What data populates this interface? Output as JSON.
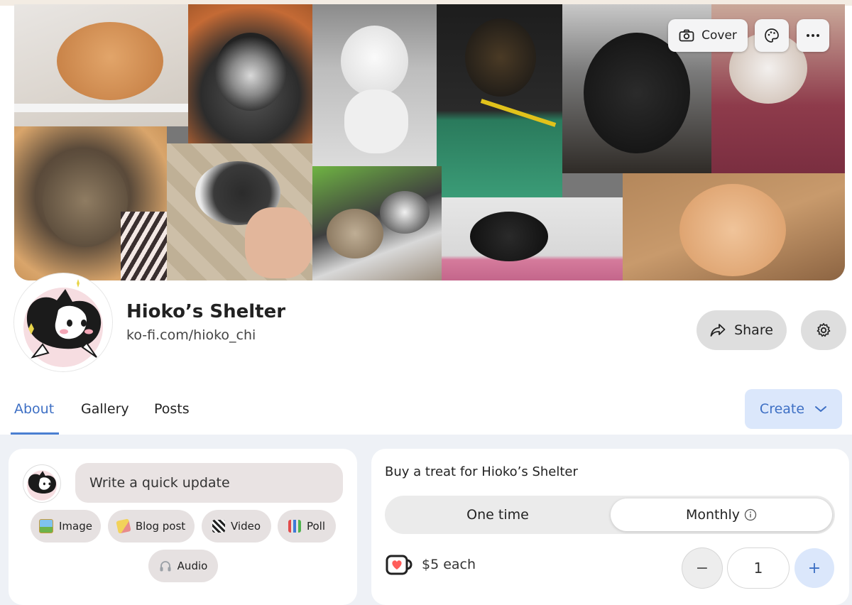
{
  "cover": {
    "cover_button": "Cover"
  },
  "profile": {
    "name": "Hioko’s Shelter",
    "url": "ko-fi.com/hioko_chi",
    "share_label": "Share"
  },
  "tabs": [
    {
      "label": "About",
      "active": true
    },
    {
      "label": "Gallery",
      "active": false
    },
    {
      "label": "Posts",
      "active": false
    }
  ],
  "create_label": "Create",
  "composer": {
    "placeholder": "Write a quick update",
    "chips": [
      {
        "label": "Image",
        "icon": "image-icon"
      },
      {
        "label": "Blog post",
        "icon": "pencil-icon"
      },
      {
        "label": "Video",
        "icon": "clapper-icon"
      },
      {
        "label": "Poll",
        "icon": "bar-chart-icon"
      },
      {
        "label": "Audio",
        "icon": "headphones-icon"
      }
    ]
  },
  "treat": {
    "title": "Buy a treat for Hioko’s Shelter",
    "one_time": "One time",
    "monthly": "Monthly",
    "selected": "Monthly",
    "price": "$5 each",
    "quantity": "1",
    "minus": "−",
    "plus": "+"
  },
  "colors": {
    "accent": "#3d6fc4",
    "create_bg": "#dbe7fb",
    "page_bg": "#eef1f6"
  }
}
